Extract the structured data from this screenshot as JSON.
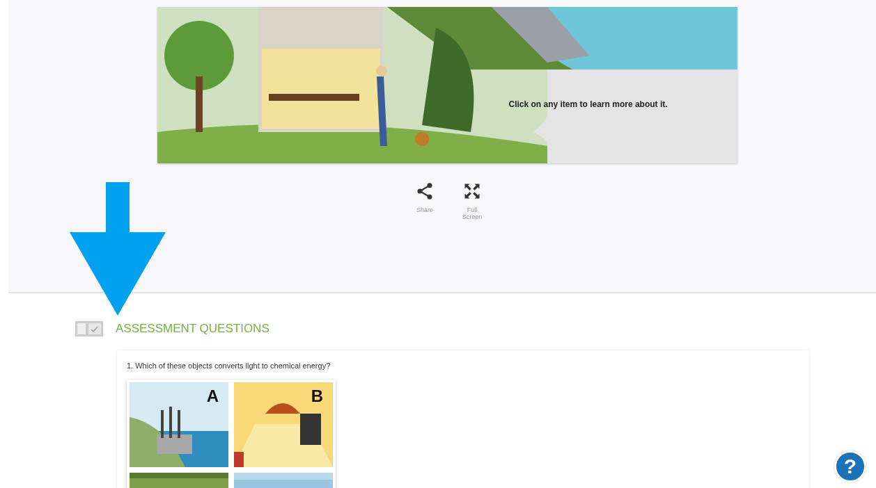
{
  "interactive": {
    "caption": "Click on any item to learn more about it."
  },
  "actions": [
    {
      "kind": "share",
      "label": "Share"
    },
    {
      "kind": "fullscreen",
      "label": "Full Screen"
    }
  ],
  "section": {
    "title": "ASSESSMENT QUESTIONS"
  },
  "question": {
    "text": "1. Which of these objects converts light to chemical energy?",
    "options": [
      {
        "kind": "factory",
        "letter": "A"
      },
      {
        "kind": "lamp",
        "letter": "B"
      },
      {
        "kind": "field"
      },
      {
        "kind": "sky"
      }
    ]
  },
  "help": {
    "label": "?"
  }
}
